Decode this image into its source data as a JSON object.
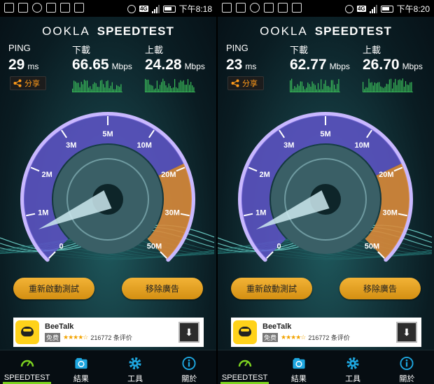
{
  "screens": [
    {
      "status": {
        "time": "下午8:18",
        "network": "4G"
      },
      "brand": {
        "ookla": "OOKLA",
        "name": "SPEEDTEST"
      },
      "ping": {
        "label": "PING",
        "value": "29",
        "unit": "ms"
      },
      "download": {
        "label": "下載",
        "value": "66.65",
        "unit": "Mbps"
      },
      "upload": {
        "label": "上載",
        "value": "24.28",
        "unit": "Mbps"
      },
      "share_label": "分享",
      "gauge_ticks": [
        "0",
        "1M",
        "2M",
        "3M",
        "5M",
        "10M",
        "20M",
        "30M",
        "50M"
      ],
      "retest_label": "重新啟動測試",
      "remove_ads_label": "移除廣告",
      "ad": {
        "title": "BeeTalk",
        "free": "免费",
        "rating": 4,
        "reviews": "216772 条评价"
      },
      "nav": [
        "SPEEDTEST",
        "結果",
        "工具",
        "關於"
      ]
    },
    {
      "status": {
        "time": "下午8:20",
        "network": "4G"
      },
      "brand": {
        "ookla": "OOKLA",
        "name": "SPEEDTEST"
      },
      "ping": {
        "label": "PING",
        "value": "23",
        "unit": "ms"
      },
      "download": {
        "label": "下載",
        "value": "62.77",
        "unit": "Mbps"
      },
      "upload": {
        "label": "上載",
        "value": "26.70",
        "unit": "Mbps"
      },
      "share_label": "分享",
      "gauge_ticks": [
        "0",
        "1M",
        "2M",
        "3M",
        "5M",
        "10M",
        "20M",
        "30M",
        "50M"
      ],
      "retest_label": "重新啟動測試",
      "remove_ads_label": "移除廣告",
      "ad": {
        "title": "BeeTalk",
        "free": "免费",
        "rating": 4,
        "reviews": "216772 条评价"
      },
      "nav": [
        "SPEEDTEST",
        "結果",
        "工具",
        "關於"
      ]
    }
  ],
  "colors": {
    "accent_orange": "#f0a12a",
    "gauge_purple": "#6b5bd6",
    "nav_active": "#7dd320",
    "graph_green": "#3bbf5a"
  },
  "icons": {
    "share": "share-icon",
    "speedtest": "speedometer-icon",
    "results": "results-icon",
    "tools": "gear-icon",
    "about": "info-icon",
    "download": "download-arrow-icon"
  }
}
